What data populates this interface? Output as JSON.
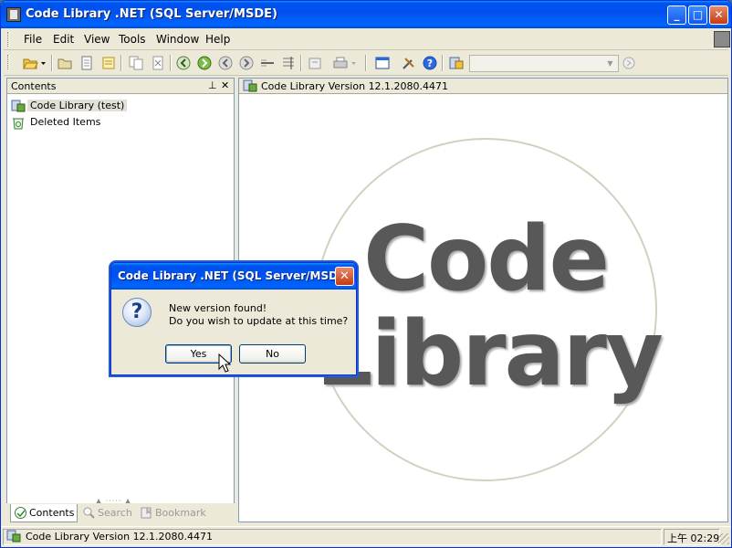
{
  "window": {
    "title": "Code Library .NET (SQL Server/MSDE)",
    "min_glyph": "_",
    "max_glyph": "□",
    "close_glyph": "✕"
  },
  "menubar": {
    "items": [
      "File",
      "Edit",
      "View",
      "Tools",
      "Window",
      "Help"
    ],
    "mdi_min": "–",
    "mdi_restore": "▫",
    "mdi_close": "✕"
  },
  "toolbar": {
    "combo_value": "",
    "combo_arrow": "▼"
  },
  "contents_pane": {
    "title": "Contents",
    "pin_glyph": "⊥",
    "close_glyph": "✕",
    "tree": [
      {
        "label": "Code Library (test)"
      },
      {
        "label": "Deleted Items"
      }
    ],
    "tabs": [
      "Contents",
      "Search",
      "Bookmark"
    ]
  },
  "document": {
    "title": "Code Library Version 12.1.2080.4471",
    "logo_line1": "Code",
    "logo_line2": "Library"
  },
  "statusbar": {
    "text": "Code Library Version 12.1.2080.4471",
    "time": "上午 02:29"
  },
  "dialog": {
    "title": "Code Library .NET (SQL Server/MSDE)",
    "close_glyph": "✕",
    "icon_glyph": "?",
    "message_line1": "New version found!",
    "message_line2": "Do you wish to update at this time?",
    "yes_label": "Yes",
    "no_label": "No"
  }
}
